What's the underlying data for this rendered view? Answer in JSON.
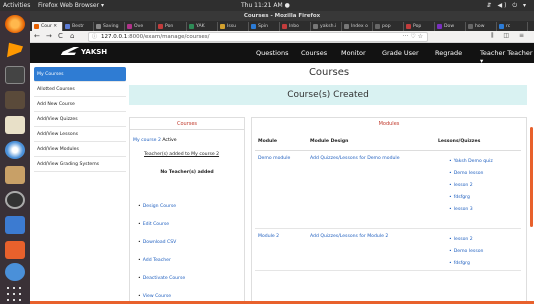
{
  "system": {
    "activities": "Activities",
    "app_name": "Firefox Web Browser ▾",
    "clock": "Thu 11:21 AM ●",
    "tray": "⇵ ◀) ⏻ ▾"
  },
  "browser": {
    "window_title": "Courses - Mozilla Firefox",
    "tabs": [
      {
        "label": "Cour ✕",
        "color": "#e66000"
      },
      {
        "label": "Bestr",
        "color": "#5b7bd5"
      },
      {
        "label": "Saving",
        "color": "#888888"
      },
      {
        "label": "Ove",
        "color": "#b0338a"
      },
      {
        "label": "Pon",
        "color": "#c23c3c"
      },
      {
        "label": "YAK",
        "color": "#2e8b57"
      },
      {
        "label": "Issu",
        "color": "#d3a12e"
      },
      {
        "label": "Spin",
        "color": "#2b7bd6"
      },
      {
        "label": "Inbo",
        "color": "#c23c3c"
      },
      {
        "label": "yaksh.i",
        "color": "#777777"
      },
      {
        "label": "Index o",
        "color": "#777777"
      },
      {
        "label": "pop",
        "color": "#666666"
      },
      {
        "label": "Pop",
        "color": "#c23c3c"
      },
      {
        "label": "Dow",
        "color": "#7a2fbf"
      },
      {
        "label": "how",
        "color": "#666666"
      },
      {
        "label": "rc",
        "color": "#2b7bd6"
      }
    ],
    "url_host": "127.0.0.1",
    "url_path": ":8000/exam/manage/courses/",
    "nav_back": "←",
    "nav_forward": "→",
    "nav_reload": "C",
    "nav_home": "⌂",
    "url_actions": "··· ♡ ☆",
    "toolbar_right": "⫼ ◫ ≡"
  },
  "site": {
    "brand": "YAKSH",
    "menu": [
      "Questions",
      "Courses",
      "Monitor",
      "Grade User",
      "Regrade",
      "Teacher Teacher ▾"
    ]
  },
  "sidebar": {
    "items": [
      {
        "label": "My Courses",
        "active": true
      },
      {
        "label": "Allotted Courses",
        "active": false
      },
      {
        "label": "Add New Course",
        "active": false
      },
      {
        "label": "Add/View Quizzes",
        "active": false
      },
      {
        "label": "Add/View Lessons",
        "active": false
      },
      {
        "label": "Add/View Modules",
        "active": false
      },
      {
        "label": "Add/View Grading Systems",
        "active": false
      }
    ]
  },
  "page": {
    "title": "Courses",
    "banner": "Course(s) Created",
    "courses_heading": "Courses",
    "modules_heading": "Modules"
  },
  "course": {
    "name": "My course 2",
    "status": "Active",
    "teachers_added": "Teacher(s) added to My course 2",
    "no_teachers": "No Teacher(s) added",
    "actions": [
      "Design Course",
      "Edit Course",
      "Download CSV",
      "Add Teacher",
      "Deactivate Course",
      "View Course"
    ]
  },
  "modules": {
    "headers": [
      "Module",
      "Module Design",
      "Lessons/Quizzes"
    ],
    "rows": [
      {
        "module": "Demo module",
        "design": "Add Quizzes/Lessons for Demo module",
        "lessons": [
          "Yaksh Demo quiz",
          "Demo lesson",
          "lesson 2",
          "fdsfgrg",
          "lesson 3"
        ]
      },
      {
        "module": "Module 2",
        "design": "Add Quizzes/Lessons for Module 2",
        "lessons": [
          "lesson 2",
          "Demo lesson",
          "fdsfgrg"
        ]
      }
    ]
  },
  "colors": {
    "accent": "#2f7cd3",
    "banner": "#d9f2f2",
    "heading_red": "#c0392b",
    "scroll_orange": "#e8612c"
  }
}
